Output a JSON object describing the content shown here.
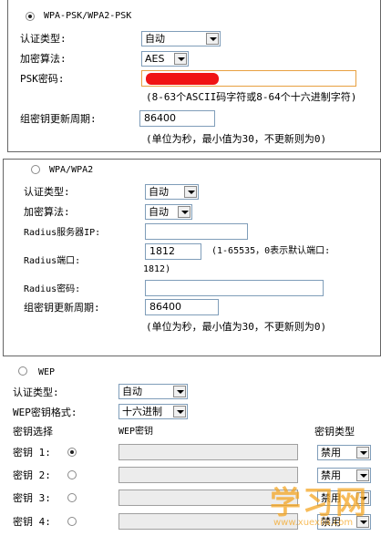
{
  "wpa_psk": {
    "title": "WPA-PSK/WPA2-PSK",
    "auth_type_label": "认证类型:",
    "auth_type_value": "自动",
    "encryption_label": "加密算法:",
    "encryption_value": "AES",
    "psk_label": "PSK密码:",
    "psk_hint": "(8-63个ASCII码字符或8-64个十六进制字符)",
    "rekey_label": "组密钥更新周期:",
    "rekey_value": "86400",
    "rekey_hint": "(单位为秒，最小值为30，不更新则为0)"
  },
  "wpa": {
    "title": "WPA/WPA2",
    "auth_type_label": "认证类型:",
    "auth_type_value": "自动",
    "encryption_label": "加密算法:",
    "encryption_value": "自动",
    "radius_ip_label": "Radius服务器IP:",
    "radius_ip_value": "",
    "radius_port_label": "Radius端口:",
    "radius_port_value": "1812",
    "radius_port_hint": "(1-65535，0表示默认端口:",
    "radius_port_hint2": "1812)",
    "radius_pwd_label": "Radius密码:",
    "radius_pwd_value": "",
    "rekey_label": "组密钥更新周期:",
    "rekey_value": "86400",
    "rekey_hint": "(单位为秒，最小值为30，不更新则为0)"
  },
  "wep": {
    "title": "WEP",
    "auth_type_label": "认证类型:",
    "auth_type_value": "自动",
    "key_format_label": "WEP密钥格式:",
    "key_format_value": "十六进制",
    "col_select": "密钥选择",
    "col_key": "WEP密钥",
    "col_type": "密钥类型",
    "keys": [
      {
        "label": "密钥 1:",
        "type": "禁用",
        "checked": true
      },
      {
        "label": "密钥 2:",
        "type": "禁用",
        "checked": false
      },
      {
        "label": "密钥 3:",
        "type": "禁用",
        "checked": false
      },
      {
        "label": "密钥 4:",
        "type": "禁用",
        "checked": false
      }
    ]
  },
  "watermark": {
    "text": "学习网",
    "url": "www.xuexila.com"
  },
  "colors": {
    "redact": "#f01414",
    "watermark": "#f5a623",
    "focus_border": "#e8a040"
  }
}
